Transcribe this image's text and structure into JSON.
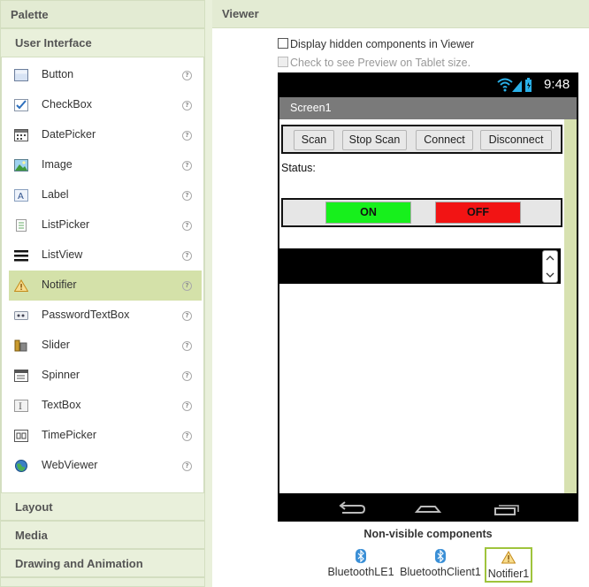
{
  "palette": {
    "title": "Palette",
    "user_interface": {
      "title": "User Interface",
      "items": [
        {
          "label": "Button",
          "icon": "button-icon"
        },
        {
          "label": "CheckBox",
          "icon": "checkbox-icon"
        },
        {
          "label": "DatePicker",
          "icon": "datepicker-icon"
        },
        {
          "label": "Image",
          "icon": "image-icon"
        },
        {
          "label": "Label",
          "icon": "label-icon"
        },
        {
          "label": "ListPicker",
          "icon": "listpicker-icon"
        },
        {
          "label": "ListView",
          "icon": "listview-icon"
        },
        {
          "label": "Notifier",
          "icon": "notifier-icon",
          "selected": true
        },
        {
          "label": "PasswordTextBox",
          "icon": "passwordtextbox-icon"
        },
        {
          "label": "Slider",
          "icon": "slider-icon"
        },
        {
          "label": "Spinner",
          "icon": "spinner-icon"
        },
        {
          "label": "TextBox",
          "icon": "textbox-icon"
        },
        {
          "label": "TimePicker",
          "icon": "timepicker-icon"
        },
        {
          "label": "WebViewer",
          "icon": "webviewer-icon"
        }
      ],
      "help_glyph": "?"
    },
    "categories": {
      "layout": "Layout",
      "media": "Media",
      "drawing": "Drawing and Animation"
    }
  },
  "viewer": {
    "title": "Viewer",
    "display_hidden": "Display hidden components in Viewer",
    "tablet_preview": "Check to see Preview on Tablet size.",
    "phone": {
      "clock": "9:48",
      "screen_title": "Screen1",
      "buttons": {
        "scan": "Scan",
        "stop_scan": "Stop Scan",
        "connect": "Connect",
        "disconnect": "Disconnect"
      },
      "status_label": "Status:",
      "on_label": "ON",
      "off_label": "OFF"
    },
    "non_visible": {
      "title": "Non-visible components",
      "items": {
        "ble": "BluetoothLE1",
        "client": "BluetoothClient1",
        "notifier": "Notifier1"
      }
    }
  },
  "colors": {
    "header_bg": "#e3ebd3",
    "selected_bg": "#d4e1a9",
    "on_button": "#17f01c",
    "off_button": "#f21414",
    "accent_border": "#9fc43c"
  }
}
